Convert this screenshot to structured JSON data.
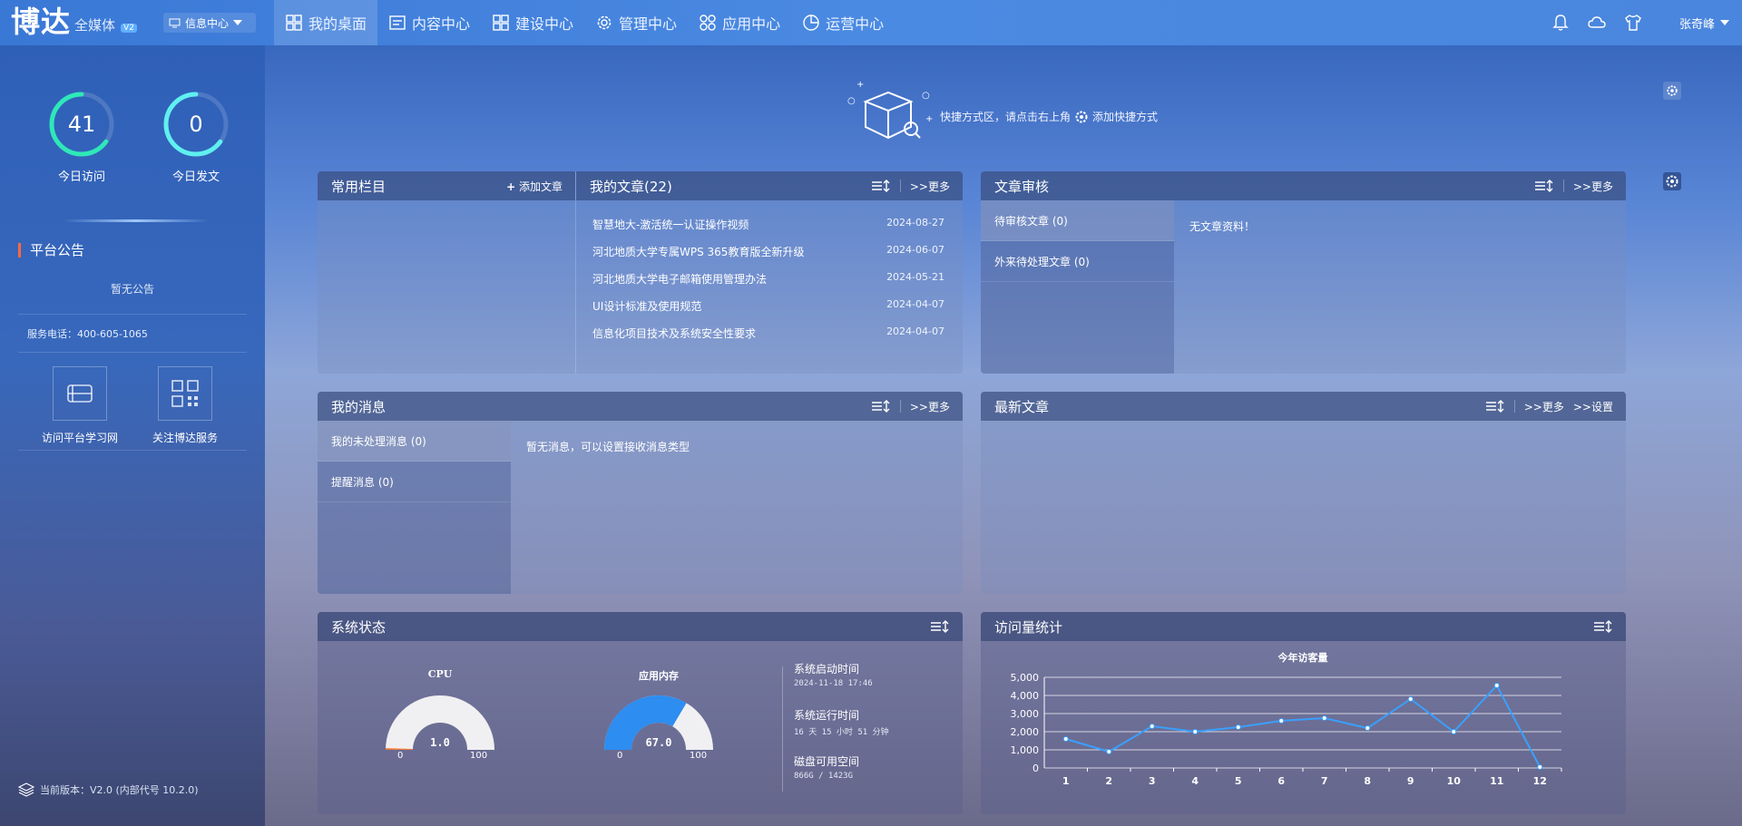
{
  "header": {
    "logo_main": "博达",
    "logo_sub": "全媒体",
    "logo_ver": "V2",
    "info_center": "信息中心",
    "nav": [
      {
        "label": "我的桌面",
        "icon": "desktop-grid-icon",
        "active": true
      },
      {
        "label": "内容中心",
        "icon": "document-icon"
      },
      {
        "label": "建设中心",
        "icon": "build-grid-icon"
      },
      {
        "label": "管理中心",
        "icon": "gear-icon"
      },
      {
        "label": "应用中心",
        "icon": "apps-icon"
      },
      {
        "label": "运营中心",
        "icon": "pie-chart-icon"
      }
    ],
    "user": "张奇峰"
  },
  "sidebar": {
    "visits": {
      "value": "41",
      "label": "今日访问",
      "progress": 0.65
    },
    "posts": {
      "value": "0",
      "label": "今日发文",
      "progress": 0.65
    },
    "notice_title": "平台公告",
    "notice_text": "暂无公告",
    "phone": "服务电话：400-605-1065",
    "links": [
      "访问平台学习网",
      "关注博达服务"
    ],
    "version": "当前版本：V2.0 (内部代号 10.2.0)"
  },
  "shortcut": {
    "text": "快捷方式区，请点击右上角",
    "action": "添加快捷方式"
  },
  "common_column": {
    "title": "常用栏目",
    "add": "添加文章"
  },
  "my_articles": {
    "title": "我的文章(22)",
    "more": ">>更多",
    "rows": [
      {
        "title": "智慧地大-激活统一认证操作视频",
        "date": "2024-08-27"
      },
      {
        "title": "河北地质大学专属WPS 365教育版全新升级",
        "date": "2024-06-07"
      },
      {
        "title": "河北地质大学电子邮箱使用管理办法",
        "date": "2024-05-21"
      },
      {
        "title": "UI设计标准及使用规范",
        "date": "2024-04-07"
      },
      {
        "title": "信息化项目技术及系统安全性要求",
        "date": "2024-04-07"
      }
    ]
  },
  "review": {
    "title": "文章审核",
    "more": ">>更多",
    "tabs": [
      "待审核文章 (0)",
      "外来待处理文章 (0)"
    ],
    "empty": "无文章资料！"
  },
  "messages": {
    "title": "我的消息",
    "more": ">>更多",
    "tabs": [
      "我的未处理消息 (0)",
      "提醒消息 (0)"
    ],
    "empty": "暂无消息，可以设置接收消息类型"
  },
  "latest": {
    "title": "最新文章",
    "more": ">>更多",
    "settings": ">>设置"
  },
  "system": {
    "title": "系统状态",
    "cpu_title": "CPU",
    "cpu_value": "1.0",
    "mem_title": "应用内存",
    "mem_value": "67.0",
    "gauge_min": "0",
    "gauge_max": "100",
    "start_label": "系统启动时间",
    "start_value": "2024-11-18 17:46",
    "run_label": "系统运行时间",
    "run_value": "16 天 15 小时 51 分钟",
    "disk_label": "磁盘可用空间",
    "disk_value": "866G / 1423G"
  },
  "visits_stats": {
    "title": "访问量统计"
  },
  "chart_data": {
    "type": "line",
    "title": "今年访客量",
    "categories": [
      "1",
      "2",
      "3",
      "4",
      "5",
      "6",
      "7",
      "8",
      "9",
      "10",
      "11",
      "12"
    ],
    "values": [
      1600,
      900,
      2300,
      2000,
      2250,
      2600,
      2750,
      2200,
      3800,
      2000,
      4550,
      50
    ],
    "ylim": [
      0,
      5000
    ],
    "yticks": [
      "0",
      "1,000",
      "2,000",
      "3,000",
      "4,000",
      "5,000"
    ],
    "grid": true,
    "color": "#3aa0ff"
  },
  "colors": {
    "accent": "#3a78d6",
    "ring_teal": "#2ee8b8",
    "ring_cyan": "#5ff0f0",
    "gauge_blue": "#2d8df0",
    "notice_bar": "#ff6a3d"
  }
}
